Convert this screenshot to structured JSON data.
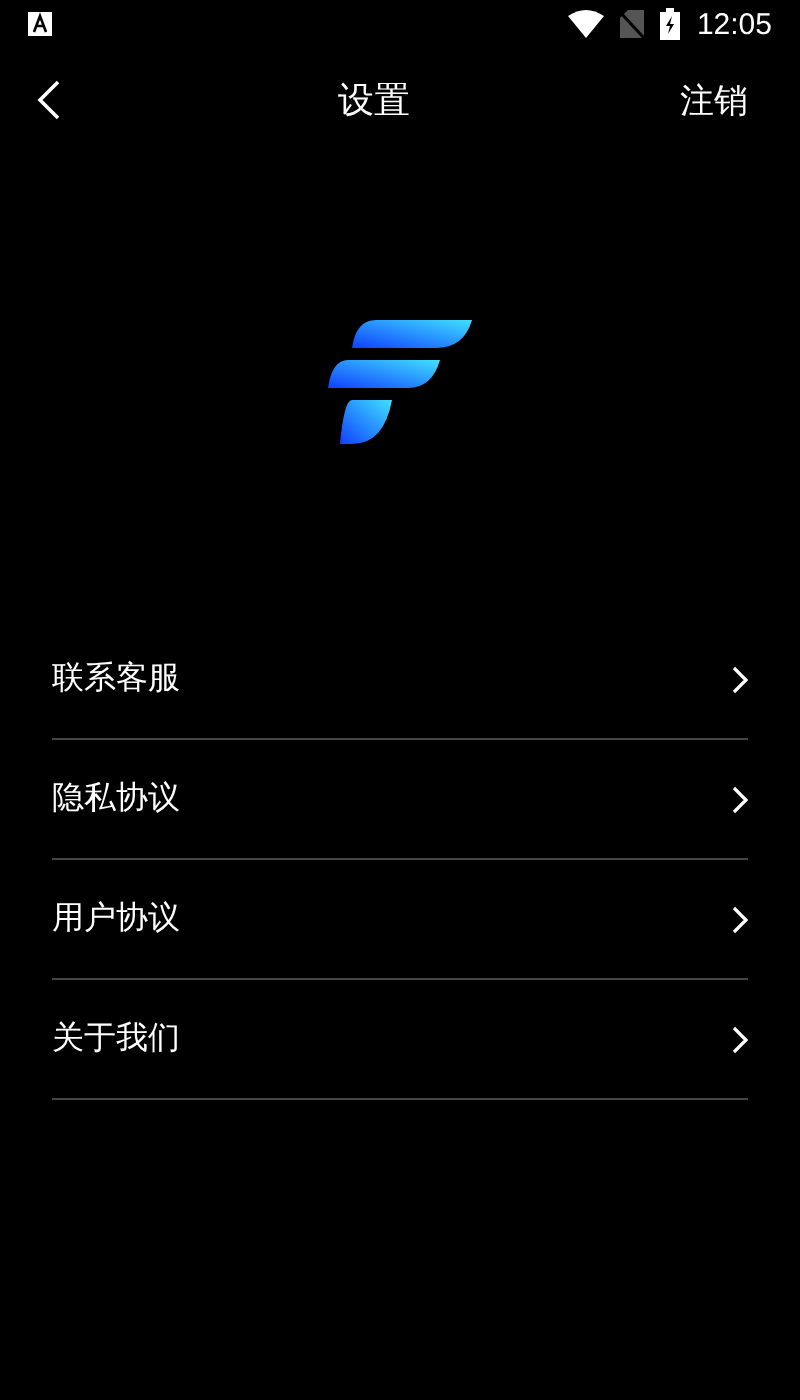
{
  "status_bar": {
    "time": "12:05"
  },
  "header": {
    "title": "设置",
    "action": "注销"
  },
  "menu": [
    {
      "label": "联系客服"
    },
    {
      "label": "隐私协议"
    },
    {
      "label": "用户协议"
    },
    {
      "label": "关于我们"
    }
  ]
}
